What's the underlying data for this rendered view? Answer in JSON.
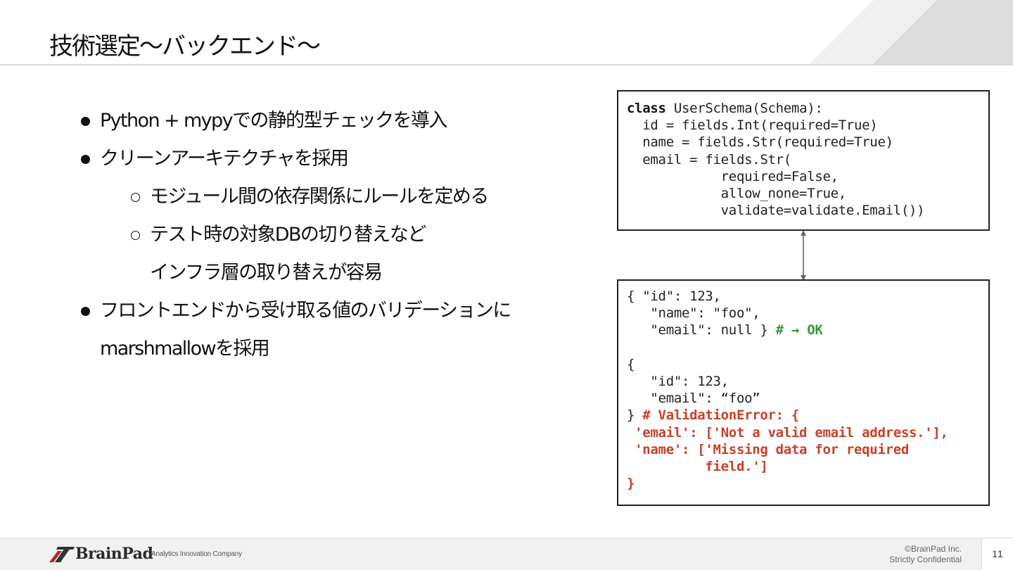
{
  "header": {
    "title": "技術選定〜バックエンド〜"
  },
  "bullets": [
    {
      "level": 1,
      "text": "Python + mypyでの静的型チェックを導入"
    },
    {
      "level": 1,
      "text": "クリーンアーキテクチャを採用"
    },
    {
      "level": 2,
      "text": "モジュール間の依存関係にルールを定める"
    },
    {
      "level": 2,
      "text": "テスト時の対象DBの切り替えなど"
    },
    {
      "level": 2,
      "text": "インフラ層の取り替えが容易"
    },
    {
      "level": 1,
      "text": "フロントエンドから受け取る値のバリデーションに"
    },
    {
      "level": 1,
      "text": "marshmallowを採用"
    }
  ],
  "code_schema": {
    "keyword": "class",
    "lines": [
      " UserSchema(Schema):",
      "  id = fields.Int(required=True)",
      "  name = fields.Str(required=True)",
      "  email = fields.Str(",
      "            required=False,",
      "            allow_none=True,",
      "            validate=validate.Email())"
    ]
  },
  "code_examples": {
    "ok_lines": [
      "{ \"id\": 123,",
      "   \"name\": \"foo\",",
      "   \"email\": null } "
    ],
    "ok_comment": "# → OK",
    "ng_lines": [
      "{",
      "   \"id\": 123,",
      "   \"email\": “foo”",
      "} "
    ],
    "error_first": "# ValidationError: {",
    "error_lines": [
      " 'email': ['Not a valid email address.'],",
      " 'name': ['Missing data for required",
      "          field.']",
      "}"
    ]
  },
  "footer": {
    "brand": "BrainPad",
    "tagline": "Analytics Innovation Company",
    "copyright": "©BrainPad Inc.",
    "confidential": "Strictly Confidential",
    "page_number": "11"
  },
  "colors": {
    "ok_comment": "#3a9a3a",
    "error_text": "#c8402a",
    "logo_red": "#b3282d"
  }
}
